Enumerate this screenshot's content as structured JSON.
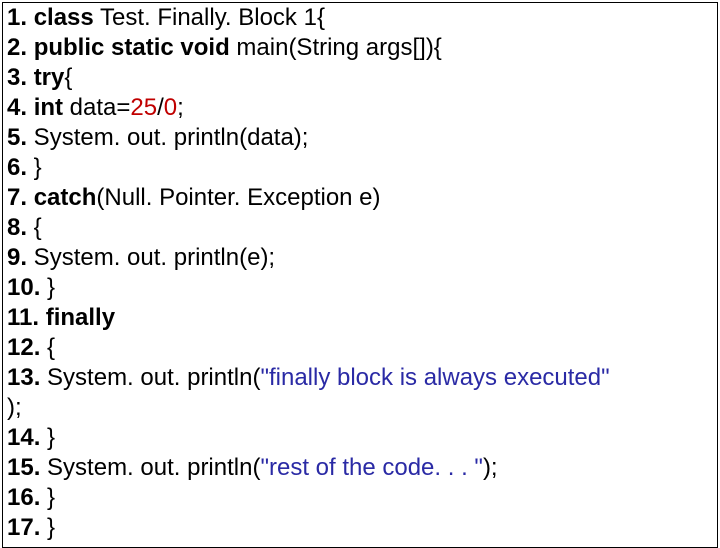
{
  "code": {
    "lines": [
      {
        "num": "1.",
        "kw1": "class",
        "rest1": " Test. Finally. Block 1{"
      },
      {
        "num": "2.",
        "kw1": "public",
        "kw2": "static",
        "kw3": "void",
        "rest1": " main(String args[]){"
      },
      {
        "num": "3.",
        "kw1": "try",
        "rest1": "{"
      },
      {
        "num": "4.",
        "kw1": "int",
        "rest1": " data=",
        "n1": "25",
        "rest2": "/",
        "n2": "0",
        "rest3": ";"
      },
      {
        "num": "5.",
        "rest1": "   System. out. println(data);"
      },
      {
        "num": "6.",
        "rest1": "  }"
      },
      {
        "num": "7.",
        "kw1": "catch",
        "rest1": "(Null. Pointer. Exception e)"
      },
      {
        "num": "8.",
        "rest1": "  {"
      },
      {
        "num": "9.",
        "rest1": "    System. out. println(e);"
      },
      {
        "num": "10.",
        "rest1": " }"
      },
      {
        "num": "11.",
        "kw1": "finally"
      },
      {
        "num": "12.",
        "rest1": " {"
      },
      {
        "num": "13.",
        "rest1": " System. out. println(",
        "str1": "\"finally block is always executed\""
      },
      {
        "rest1": ");"
      },
      {
        "num": "14.",
        "rest1": "  }"
      },
      {
        "num": "15.",
        "rest1": "  System. out. println(",
        "str1": "\"rest of the code. . . \"",
        "rest2": ");"
      },
      {
        "num": "16.",
        "rest1": "  }"
      },
      {
        "num": "17.",
        "rest1": " }"
      }
    ]
  }
}
